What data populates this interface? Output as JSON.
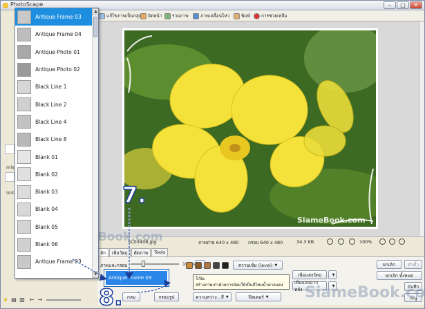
{
  "window": {
    "title": "PhotoScape",
    "minimize": "–",
    "maximize": "□",
    "close": "✕"
  },
  "toolbar": {
    "items": [
      {
        "label": "แก้ไขภาพเป็นกลุ่ม",
        "icon": "batch-edit-icon"
      },
      {
        "label": "จัดหน้า",
        "icon": "page-icon"
      },
      {
        "label": "รวมภาพ",
        "icon": "combine-icon"
      },
      {
        "label": "ภาพเคลื่อนไหว",
        "icon": "gif-icon"
      },
      {
        "label": "พิมพ์",
        "icon": "print-icon"
      },
      {
        "label": "การช่วยเหลือ",
        "icon": "help-icon"
      }
    ]
  },
  "left_panel": {
    "text1": "mis",
    "text2": "Unti"
  },
  "frame_dropdown": {
    "items": [
      {
        "label": "Antique Frame 03",
        "selected": true
      },
      {
        "label": "Antique Frame 04"
      },
      {
        "label": "Antique Photo 01"
      },
      {
        "label": "Antique Photo 02"
      },
      {
        "label": "Black Line 1"
      },
      {
        "label": "Black Line 2"
      },
      {
        "label": "Black Line 4"
      },
      {
        "label": "Black Line 8"
      },
      {
        "label": "Blank 01"
      },
      {
        "label": "Blank 02"
      },
      {
        "label": "Blank 03"
      },
      {
        "label": "Blank 04"
      },
      {
        "label": "Blank 05"
      },
      {
        "label": "Blank 06"
      },
      {
        "label": "Antique Frame 03"
      }
    ]
  },
  "photo": {
    "watermark": "SiameBook.com"
  },
  "status": {
    "filename": "SC03408.jpg",
    "image_size": "ภาพถ่าย 640 x 480",
    "frame_size": "กรอบ 640 x 480",
    "file_size": "34.3 KB",
    "zoom": "100%"
  },
  "tabs": [
    "ฮัก",
    "เพิ่มวัตถุ",
    "ตัดภาพ",
    "Tools"
  ],
  "panel": {
    "frame_label": "ภาพและกรอบ",
    "frame_percent": "100%",
    "selected_frame": "Antique Frame 03",
    "tooltip_line1": "ใเปิน",
    "tooltip_line2": "สร้างภาพเก่าด้วยการย้อมให้เป็นสีโทนน้ำตาลแดง",
    "btn_level": "ความเข้ม (level)",
    "btn_add_frame": "เพิ่มแสงวัตถุ",
    "btn_add_bg": "เพิ่มแสงฉากหลัง",
    "btn_brightness": "ความสว่าง , สี",
    "btn_filter": "ฟิลเตอร์",
    "btn_crop": "กรอบรูป",
    "btn_circle": "กลม",
    "btn_undo": "ยกเลิก",
    "btn_redo": "ทำซ้ำ",
    "btn_undo_all": "ยกเลิก ทั้งหมด",
    "btn_save": "บันทึก",
    "btn_menu": "เมนู"
  },
  "annotations": {
    "step7": "7.",
    "step8": "8."
  },
  "watermarks": {
    "left": "SiameBook.com",
    "bottom": "SiameBook.com"
  }
}
